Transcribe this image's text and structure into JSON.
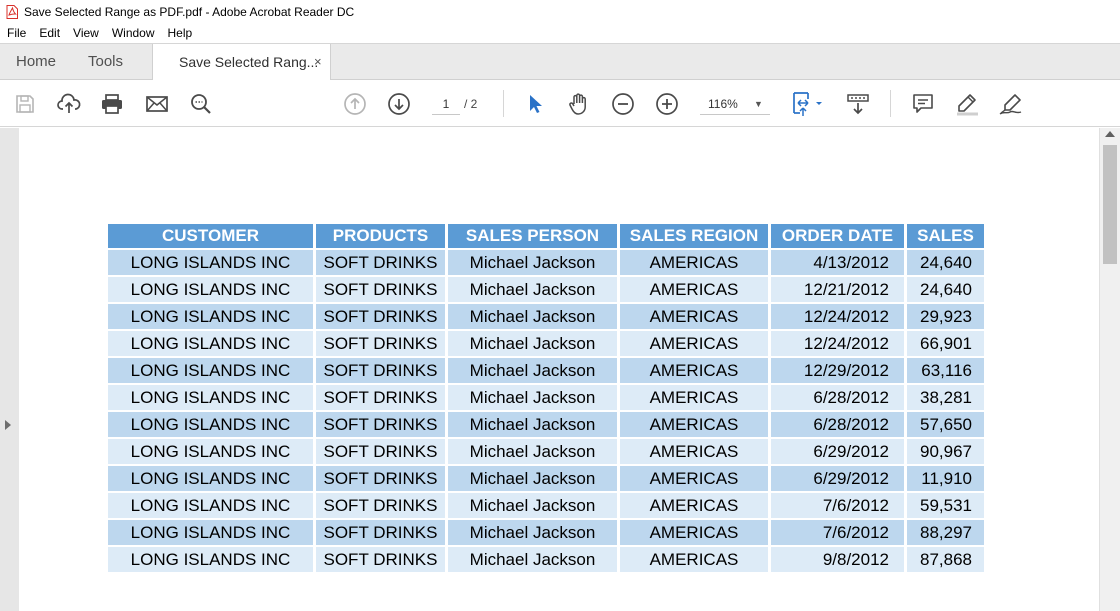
{
  "window": {
    "title": "Save Selected Range as PDF.pdf - Adobe Acrobat Reader DC"
  },
  "menu": [
    "File",
    "Edit",
    "View",
    "Window",
    "Help"
  ],
  "tabs": {
    "home": "Home",
    "tools": "Tools",
    "document": "Save Selected Rang...",
    "close": "×"
  },
  "toolbar": {
    "page_current": "1",
    "page_total": "/  2",
    "zoom": "116%",
    "zoom_caret": "▼"
  },
  "colors": {
    "header_fill": "#5b9bd5",
    "row_dark": "#bdd7ee",
    "row_light": "#ddebf7",
    "accent_icon": "#2a72c7",
    "pdf_icon": "#d9302a"
  },
  "table": {
    "headers": [
      "CUSTOMER",
      "PRODUCTS",
      "SALES PERSON",
      "SALES REGION",
      "ORDER DATE",
      "SALES"
    ],
    "rows": [
      [
        "LONG ISLANDS INC",
        "SOFT DRINKS",
        "Michael Jackson",
        "AMERICAS",
        "4/13/2012",
        "24,640"
      ],
      [
        "LONG ISLANDS INC",
        "SOFT DRINKS",
        "Michael Jackson",
        "AMERICAS",
        "12/21/2012",
        "24,640"
      ],
      [
        "LONG ISLANDS INC",
        "SOFT DRINKS",
        "Michael Jackson",
        "AMERICAS",
        "12/24/2012",
        "29,923"
      ],
      [
        "LONG ISLANDS INC",
        "SOFT DRINKS",
        "Michael Jackson",
        "AMERICAS",
        "12/24/2012",
        "66,901"
      ],
      [
        "LONG ISLANDS INC",
        "SOFT DRINKS",
        "Michael Jackson",
        "AMERICAS",
        "12/29/2012",
        "63,116"
      ],
      [
        "LONG ISLANDS INC",
        "SOFT DRINKS",
        "Michael Jackson",
        "AMERICAS",
        "6/28/2012",
        "38,281"
      ],
      [
        "LONG ISLANDS INC",
        "SOFT DRINKS",
        "Michael Jackson",
        "AMERICAS",
        "6/28/2012",
        "57,650"
      ],
      [
        "LONG ISLANDS INC",
        "SOFT DRINKS",
        "Michael Jackson",
        "AMERICAS",
        "6/29/2012",
        "90,967"
      ],
      [
        "LONG ISLANDS INC",
        "SOFT DRINKS",
        "Michael Jackson",
        "AMERICAS",
        "6/29/2012",
        "11,910"
      ],
      [
        "LONG ISLANDS INC",
        "SOFT DRINKS",
        "Michael Jackson",
        "AMERICAS",
        "7/6/2012",
        "59,531"
      ],
      [
        "LONG ISLANDS INC",
        "SOFT DRINKS",
        "Michael Jackson",
        "AMERICAS",
        "7/6/2012",
        "88,297"
      ],
      [
        "LONG ISLANDS INC",
        "SOFT DRINKS",
        "Michael Jackson",
        "AMERICAS",
        "9/8/2012",
        "87,868"
      ]
    ]
  }
}
